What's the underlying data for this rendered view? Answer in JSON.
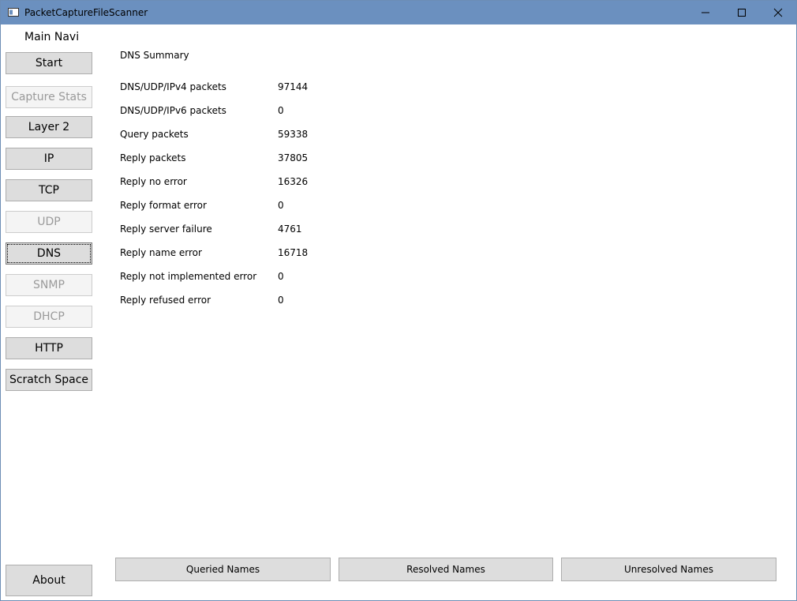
{
  "window": {
    "title": "PacketCaptureFileScanner"
  },
  "nav": {
    "title": "Main Navi",
    "items": [
      {
        "label": "Start",
        "state": "enabled"
      },
      {
        "label": "Capture Stats",
        "state": "disabled"
      },
      {
        "label": "Layer 2",
        "state": "enabled"
      },
      {
        "label": "IP",
        "state": "enabled"
      },
      {
        "label": "TCP",
        "state": "enabled"
      },
      {
        "label": "UDP",
        "state": "disabled"
      },
      {
        "label": "DNS",
        "state": "focused"
      },
      {
        "label": "SNMP",
        "state": "disabled"
      },
      {
        "label": "DHCP",
        "state": "disabled"
      },
      {
        "label": "HTTP",
        "state": "enabled"
      },
      {
        "label": "Scratch Space",
        "state": "enabled"
      }
    ],
    "about": "About"
  },
  "summary": {
    "title": "DNS Summary",
    "rows": [
      {
        "label": "DNS/UDP/IPv4 packets",
        "value": "97144"
      },
      {
        "label": "DNS/UDP/IPv6 packets",
        "value": "0"
      },
      {
        "label": "Query packets",
        "value": "59338"
      },
      {
        "label": "Reply packets",
        "value": "37805"
      },
      {
        "label": "Reply no error",
        "value": "16326"
      },
      {
        "label": "Reply format error",
        "value": "0"
      },
      {
        "label": "Reply server failure",
        "value": "4761"
      },
      {
        "label": "Reply name error",
        "value": "16718"
      },
      {
        "label": "Reply not implemented error",
        "value": "0"
      },
      {
        "label": "Reply refused error",
        "value": "0"
      }
    ]
  },
  "actions": {
    "queried": "Queried Names",
    "resolved": "Resolved Names",
    "unresolved": "Unresolved Names"
  },
  "colors": {
    "titlebar": "#6b90bf",
    "button_face": "#dddddd",
    "button_border": "#adadad",
    "disabled_text": "#9a9a9a"
  }
}
